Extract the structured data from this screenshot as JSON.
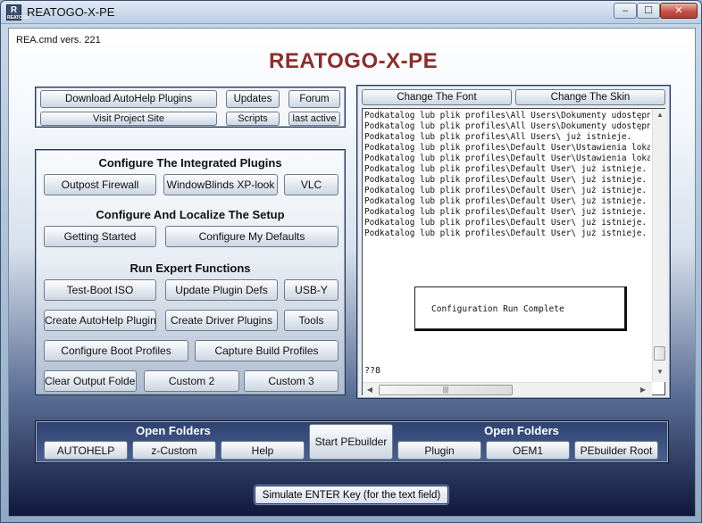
{
  "window": {
    "title": "REATOGO-X-PE",
    "icon_label": "R",
    "icon_sub": "REATOGO",
    "controls": {
      "minimize": "‒",
      "maximize": "☐",
      "close": "✕"
    }
  },
  "header": {
    "version": "REA.cmd vers. 221",
    "title": "REATOGO-X-PE"
  },
  "top_links": {
    "download_autohelp": "Download AutoHelp Plugins",
    "updates": "Updates",
    "forum": "Forum",
    "visit_project": "Visit Project Site",
    "scripts": "Scripts",
    "last_active": "last active"
  },
  "plugins_section": {
    "heading": "Configure The Integrated Plugins",
    "outpost": "Outpost Firewall",
    "windowblinds": "WindowBlinds XP-look",
    "vlc": "VLC"
  },
  "setup_section": {
    "heading": "Configure And Localize The Setup",
    "getting_started": "Getting Started",
    "configure_defaults": "Configure My Defaults"
  },
  "expert_section": {
    "heading": "Run Expert Functions",
    "test_boot": "Test-Boot ISO",
    "update_plugin_defs": "Update Plugin Defs",
    "usb_y": "USB-Y",
    "create_autohelp": "Create AutoHelp Plugins",
    "create_driver": "Create Driver Plugins",
    "tools": "Tools",
    "configure_boot": "Configure Boot Profiles",
    "capture_build": "Capture Build Profiles",
    "clear_output": "Clear Output Folder",
    "custom2": "Custom 2",
    "custom3": "Custom 3"
  },
  "output_panel": {
    "change_font": "Change The Font",
    "change_skin": "Change The Skin",
    "lines": [
      "Podkatalog lub plik profiles\\All Users\\Dokumenty udostępnione\\ j",
      "Podkatalog lub plik profiles\\All Users\\Dokumenty udostępnione\\ j",
      "Podkatalog lub plik profiles\\All Users\\ już istnieje.",
      "Podkatalog lub plik profiles\\Default User\\Ustawienia lokalne\\ ju",
      "Podkatalog lub plik profiles\\Default User\\Ustawienia lokalne\\ ju",
      "Podkatalog lub plik profiles\\Default User\\ już istnieje.",
      "Podkatalog lub plik profiles\\Default User\\ już istnieje.",
      "Podkatalog lub plik profiles\\Default User\\ już istnieje.",
      "Podkatalog lub plik profiles\\Default User\\ już istnieje.",
      "Podkatalog lub plik profiles\\Default User\\ już istnieje.",
      "Podkatalog lub plik profiles\\Default User\\ już istnieje.",
      "Podkatalog lub plik profiles\\Default User\\ już istnieje."
    ],
    "dialog_text": "Configuration Run Complete",
    "prompt": "??8",
    "hscroll_grip": "|||"
  },
  "folders_bar": {
    "left_heading": "Open Folders",
    "right_heading": "Open Folders",
    "autohelp": "AUTOHELP",
    "z_custom": "z-Custom",
    "help": "Help",
    "start_pebuilder": "Start PEbuilder",
    "plugin": "Plugin",
    "oem1": "OEM1",
    "pebuilder_root": "PEbuilder Root"
  },
  "footer": {
    "simulate_enter": "Simulate ENTER Key  (for the text field)"
  }
}
